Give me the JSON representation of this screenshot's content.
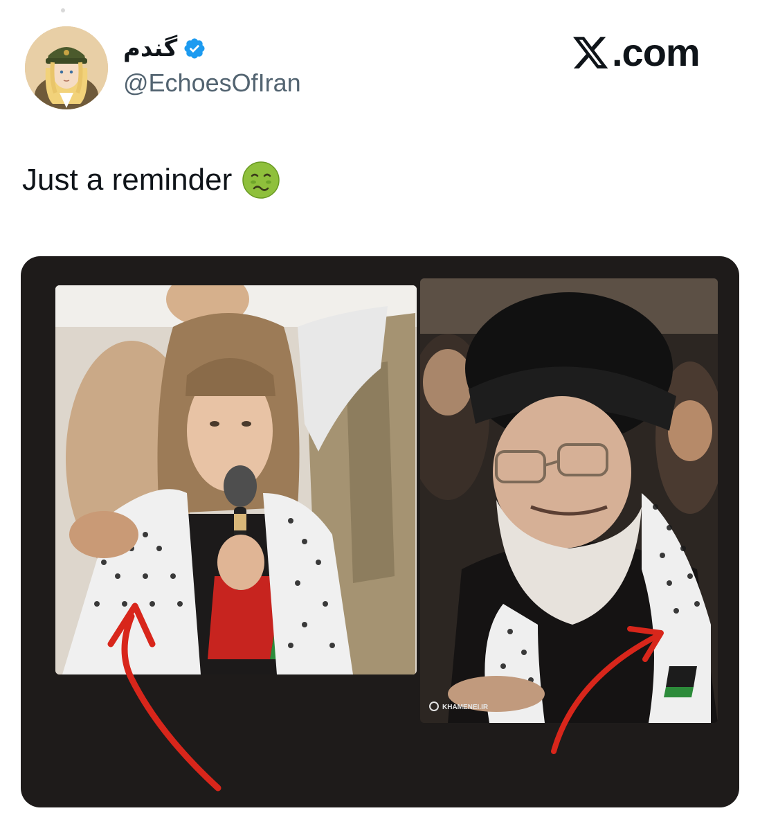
{
  "profile": {
    "display_name": "گندم",
    "handle": "@EchoesOfIran",
    "avatar_icon": "anime-soldier-avatar-icon",
    "verified_icon": "verified-badge-icon"
  },
  "brand": {
    "logo_icon": "x-logo-icon",
    "text": ".com"
  },
  "tweet": {
    "text": "Just a reminder",
    "emoji_icon": "nauseated-face-emoji-icon"
  },
  "media": {
    "left_photo_icon": "photo-young-activist-with-keffiyeh",
    "right_photo_icon": "photo-cleric-with-keffiyeh",
    "arrow_color": "#d8261b",
    "watermark": "KHAMENEI.IR"
  },
  "colors": {
    "verified": "#1d9bf0",
    "text_primary": "#0f1419",
    "text_secondary": "#536471",
    "card_background": "#1e1b1a"
  }
}
